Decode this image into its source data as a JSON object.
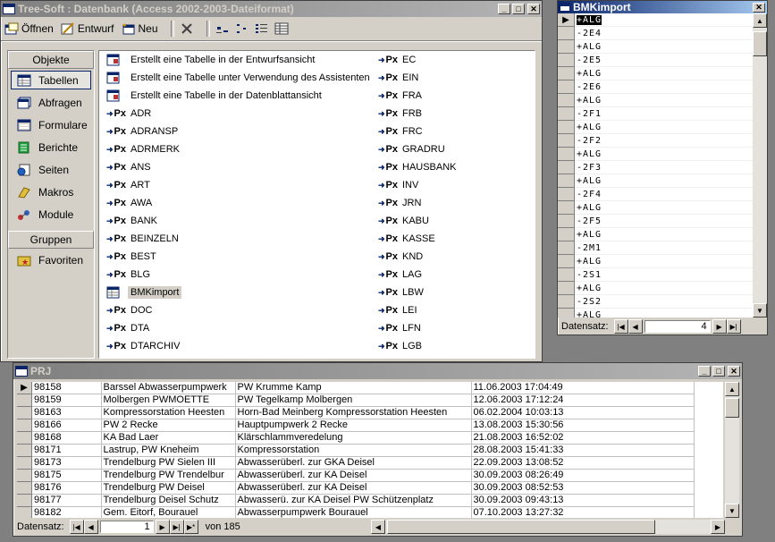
{
  "db_window": {
    "title": "Tree-Soft : Datenbank (Access 2002-2003-Dateiformat)",
    "toolbar": {
      "open": "Öffnen",
      "design": "Entwurf",
      "new": "Neu"
    },
    "objects_header": "Objekte",
    "objects": [
      "Tabellen",
      "Abfragen",
      "Formulare",
      "Berichte",
      "Seiten",
      "Makros",
      "Module"
    ],
    "groups_header": "Gruppen",
    "groups": [
      "Favoriten"
    ],
    "list_col1": [
      {
        "label": "Erstellt eine Tabelle in der Entwurfsansicht",
        "icon": "wizard"
      },
      {
        "label": "Erstellt eine Tabelle unter Verwendung des Assistenten",
        "icon": "wizard"
      },
      {
        "label": "Erstellt eine Tabelle in der Datenblattansicht",
        "icon": "wizard"
      },
      {
        "label": "ADR",
        "icon": "px"
      },
      {
        "label": "ADRANSP",
        "icon": "px"
      },
      {
        "label": "ADRMERK",
        "icon": "px"
      },
      {
        "label": "ANS",
        "icon": "px"
      },
      {
        "label": "ART",
        "icon": "px"
      },
      {
        "label": "AWA",
        "icon": "px"
      },
      {
        "label": "BANK",
        "icon": "px"
      },
      {
        "label": "BEINZELN",
        "icon": "px"
      },
      {
        "label": "BEST",
        "icon": "px"
      },
      {
        "label": "BLG",
        "icon": "px"
      },
      {
        "label": "BMKimport",
        "icon": "table"
      },
      {
        "label": "DOC",
        "icon": "px"
      },
      {
        "label": "DTA",
        "icon": "px"
      },
      {
        "label": "DTARCHIV",
        "icon": "px"
      }
    ],
    "list_col2": [
      "EC",
      "EIN",
      "FRA",
      "FRB",
      "FRC",
      "GRADRU",
      "HAUSBANK",
      "INV",
      "JRN",
      "KABU",
      "KASSE",
      "KND",
      "LAG",
      "LBW",
      "LEI",
      "LFN",
      "LGB"
    ]
  },
  "bm_window": {
    "title": "BMKimport",
    "rows": [
      "+ALG",
      "-2E4",
      "+ALG",
      "-2E5",
      "+ALG",
      "-2E6",
      "+ALG",
      "-2F1",
      "+ALG",
      "-2F2",
      "+ALG",
      "-2F3",
      "+ALG",
      "-2F4",
      "+ALG",
      "-2F5",
      "+ALG",
      "-2M1",
      "+ALG",
      "-2S1",
      "+ALG",
      "-2S2",
      "+ALG"
    ],
    "nav_label": "Datensatz:",
    "record": "4"
  },
  "prj_window": {
    "title": "PRJ",
    "rows": [
      [
        "98158",
        "Barssel Abwasserpumpwerk",
        "PW Krumme Kamp",
        "11.06.2003 17:04:49"
      ],
      [
        "98159",
        "Molbergen PWMOETTE",
        "PW Tegelkamp Molbergen",
        "12.06.2003 17:12:24"
      ],
      [
        "98163",
        "Kompressorstation Heesten",
        "Horn-Bad Meinberg Kompressorstation Heesten",
        "06.02.2004 10:03:13"
      ],
      [
        "98166",
        "PW 2 Recke",
        "Hauptpumpwerk 2 Recke",
        "13.08.2003 15:30:56"
      ],
      [
        "98168",
        "KA Bad Laer",
        "Klärschlammveredelung",
        "21.08.2003 16:52:02"
      ],
      [
        "98171",
        "Lastrup, PW Kneheim",
        "Kompressorstation",
        "28.08.2003 15:41:33"
      ],
      [
        "98173",
        "Trendelburg PW Sielen III",
        "Abwasserüberl. zur GKA Deisel",
        "22.09.2003 13:08:52"
      ],
      [
        "98175",
        "Trendelburg PW Trendelbur",
        "Abwasserüberl. zur KA Deisel",
        "30.09.2003 08:26:49"
      ],
      [
        "98176",
        "Trendelburg PW Deisel",
        "Abwasserüberl. zur KA Deisel",
        "30.09.2003 08:52:53"
      ],
      [
        "98177",
        "Trendelburg Deisel Schutz",
        "Abwasserü. zur KA Deisel PW Schützenplatz",
        "30.09.2003 09:43:13"
      ],
      [
        "98182",
        "Gem. Eitorf, Bourauel",
        "Abwasserpumpwerk Bourauel",
        "07.10.2003 13:27:32"
      ]
    ],
    "nav_label": "Datensatz:",
    "record": "1",
    "of_text": "von 185"
  }
}
